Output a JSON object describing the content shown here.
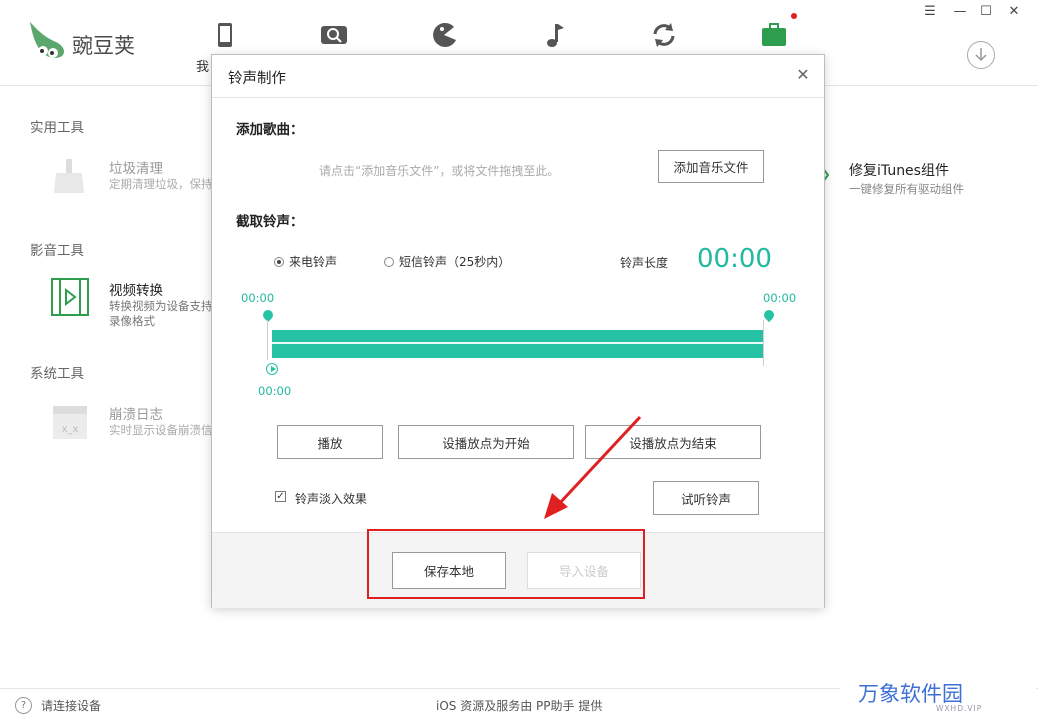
{
  "header": {
    "logo_text": "豌豆荚",
    "nav_label_partial": "我",
    "nav_icons": [
      "phone-icon",
      "search-icon",
      "game-icon",
      "music-icon",
      "sync-icon",
      "toolbox-icon"
    ],
    "window_controls": [
      "menu-icon",
      "minimize-icon",
      "maximize-icon",
      "close-icon"
    ]
  },
  "sections": [
    {
      "title": "实用工具",
      "tools": [
        {
          "name": "垃圾清理",
          "desc": "定期清理垃圾，保持",
          "icon": "broom-icon"
        }
      ]
    },
    {
      "title": "影音工具",
      "tools": [
        {
          "name": "视频转换",
          "desc": "转换视频为设备支持录像格式",
          "icon": "video-convert-icon"
        }
      ]
    },
    {
      "title": "系统工具",
      "tools": [
        {
          "name": "崩溃日志",
          "desc": "实时显示设备崩溃信",
          "icon": "crash-log-icon"
        }
      ]
    }
  ],
  "right_tool": {
    "name": "修复iTunes组件",
    "desc": "一键修复所有驱动组件"
  },
  "footer": {
    "status": "请连接设备",
    "provider": "iOS 资源及服务由 PP助手 提供"
  },
  "watermark": {
    "main": "万象软件园",
    "sub": "WXHD.VIP"
  },
  "dialog": {
    "title": "铃声制作",
    "add_song_label": "添加歌曲：",
    "add_hint": "请点击“添加音乐文件”，或将文件拖拽至此。",
    "add_button": "添加音乐文件",
    "cut_label": "截取铃声：",
    "radio_call": "来电铃声",
    "radio_sms": "短信铃声（25秒内）",
    "length_label": "铃声长度",
    "length_value": "00:00",
    "start_time": "00:00",
    "end_time": "00:00",
    "play_time": "00:00",
    "play_button": "播放",
    "set_start_button": "设播放点为开始",
    "set_end_button": "设播放点为结束",
    "fade_label": "铃声淡入效果",
    "fade_checked": true,
    "preview_button": "试听铃声",
    "save_button": "保存本地",
    "import_button": "导入设备"
  },
  "colors": {
    "accent": "#26c2a4",
    "annotation": "#e02020",
    "watermark": "#3d6fd6"
  }
}
